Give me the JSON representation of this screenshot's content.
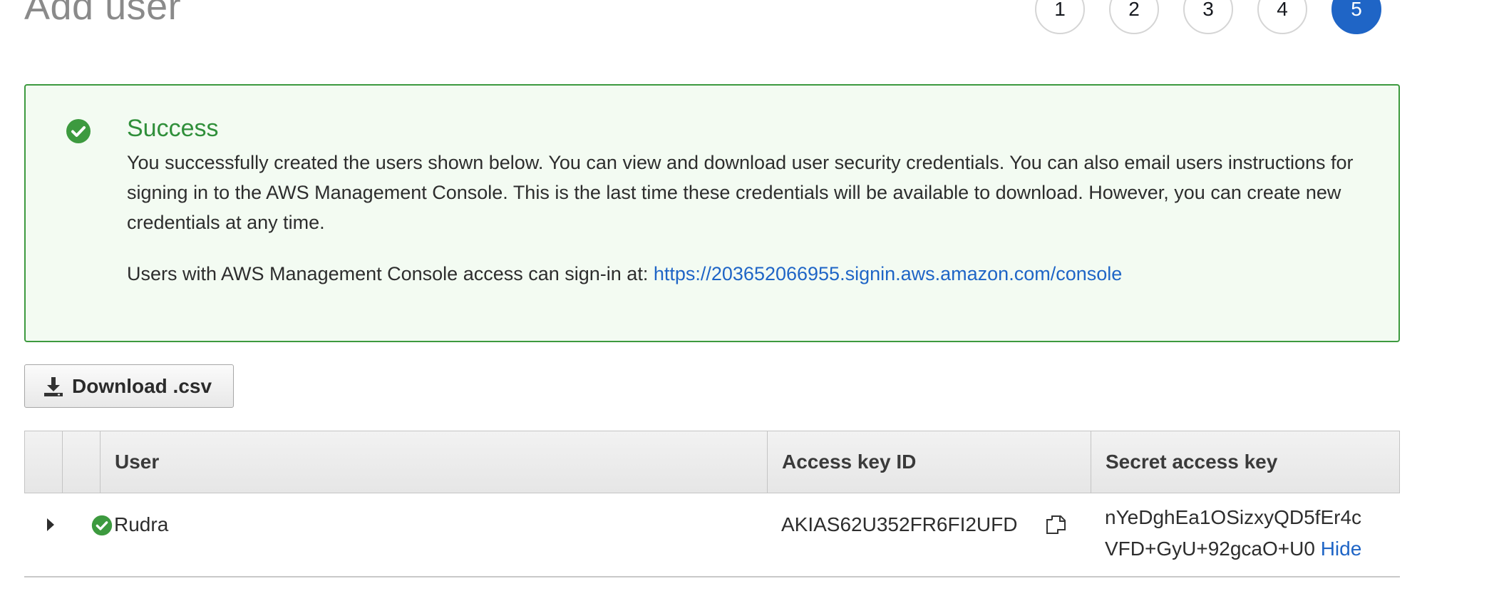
{
  "page": {
    "title": "Add user"
  },
  "steps": [
    "1",
    "2",
    "3",
    "4",
    "5"
  ],
  "active_step": "5",
  "colors": {
    "success": "#3d9a3f",
    "link": "#1f65c6",
    "active_step": "#1f65c6"
  },
  "alert": {
    "icon": "check-circle-icon",
    "title": "Success",
    "text": "You successfully created the users shown below. You can view and download user security credentials. You can also email users instructions for signing in to the AWS Management Console. This is the last time these credentials will be available to download. However, you can create new credentials at any time.",
    "signin_label": "Users with AWS Management Console access can sign-in at:",
    "signin_url": "https://203652066955.signin.aws.amazon.com/console"
  },
  "download": {
    "label": "Download .csv",
    "icon": "download-icon"
  },
  "table": {
    "columns": [
      "User",
      "Access key ID",
      "Secret access key"
    ],
    "rows": [
      {
        "user": "Rudra",
        "access_key_id": "AKIAS62U352FR6FI2UFD",
        "secret_line1": "nYeDghEa1OSizxyQD5fEr4c",
        "secret_line2": "VFD+GyU+92gcaO+U0",
        "hide_label": "Hide"
      }
    ]
  }
}
